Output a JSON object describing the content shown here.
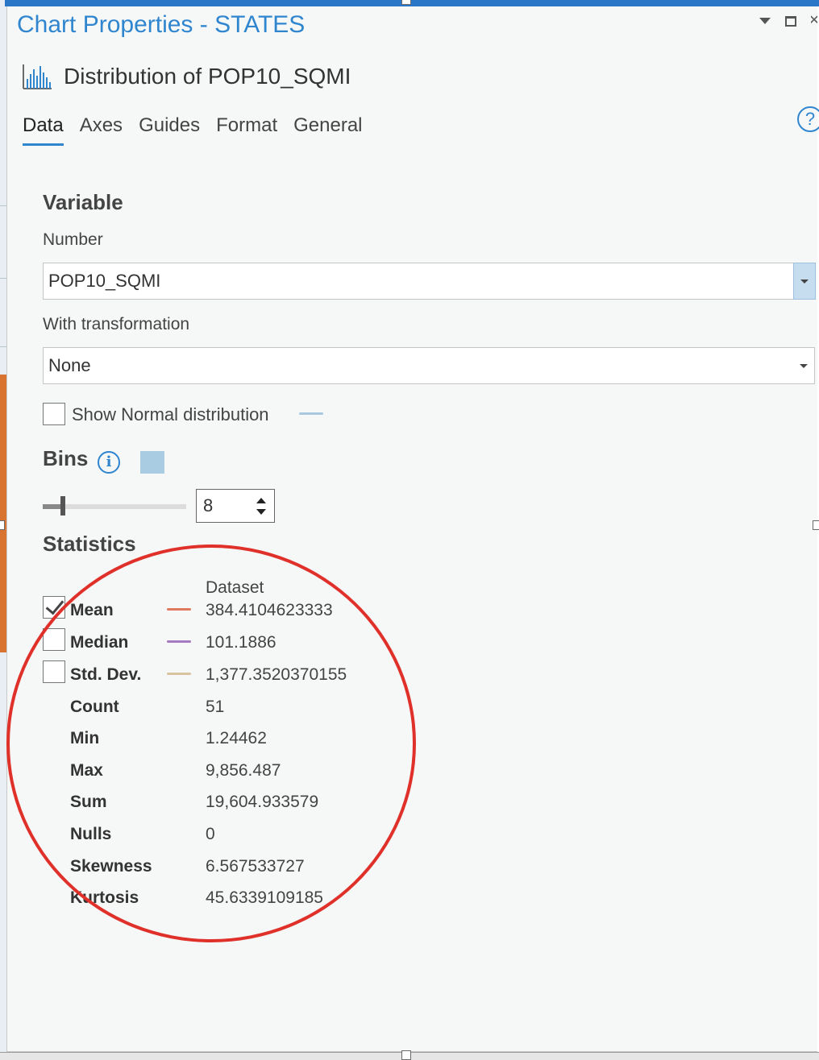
{
  "window": {
    "title": "Chart Properties - STATES",
    "menu_icon": "dropdown-triangle-icon",
    "maximize_icon": "maximize-icon",
    "close_icon": "close-icon"
  },
  "chart": {
    "icon": "histogram-icon",
    "name": "Distribution of POP10_SQMI"
  },
  "tabs": [
    {
      "label": "Data",
      "active": true
    },
    {
      "label": "Axes",
      "active": false
    },
    {
      "label": "Guides",
      "active": false
    },
    {
      "label": "Format",
      "active": false
    },
    {
      "label": "General",
      "active": false
    }
  ],
  "help_icon": "?",
  "variable": {
    "heading": "Variable",
    "number_label": "Number",
    "number_value": "POP10_SQMI",
    "transform_label": "With transformation",
    "transform_value": "None",
    "show_normal_label": "Show Normal distribution",
    "show_normal_checked": false,
    "normal_color": "#a9c8e0"
  },
  "bins": {
    "heading": "Bins",
    "info_icon": "i",
    "swatch_color": "#a9cce3",
    "value": "8"
  },
  "statistics": {
    "heading": "Statistics",
    "column_header": "Dataset",
    "rows": [
      {
        "name": "Mean",
        "value": "384.4104623333",
        "checkbox": true,
        "checked": true,
        "line_color": "#e07a5f"
      },
      {
        "name": "Median",
        "value": "101.1886",
        "checkbox": true,
        "checked": false,
        "line_color": "#a77bc0"
      },
      {
        "name": "Std. Dev.",
        "value": "1,377.3520370155",
        "checkbox": true,
        "checked": false,
        "line_color": "#d8c3a0"
      },
      {
        "name": "Count",
        "value": "51"
      },
      {
        "name": "Min",
        "value": "1.24462"
      },
      {
        "name": "Max",
        "value": "9,856.487"
      },
      {
        "name": "Sum",
        "value": "19,604.933579"
      },
      {
        "name": "Nulls",
        "value": "0"
      },
      {
        "name": "Skewness",
        "value": "6.567533727"
      },
      {
        "name": "Kurtosis",
        "value": "45.6339109185"
      }
    ]
  },
  "annotation_color": "#e0302a"
}
